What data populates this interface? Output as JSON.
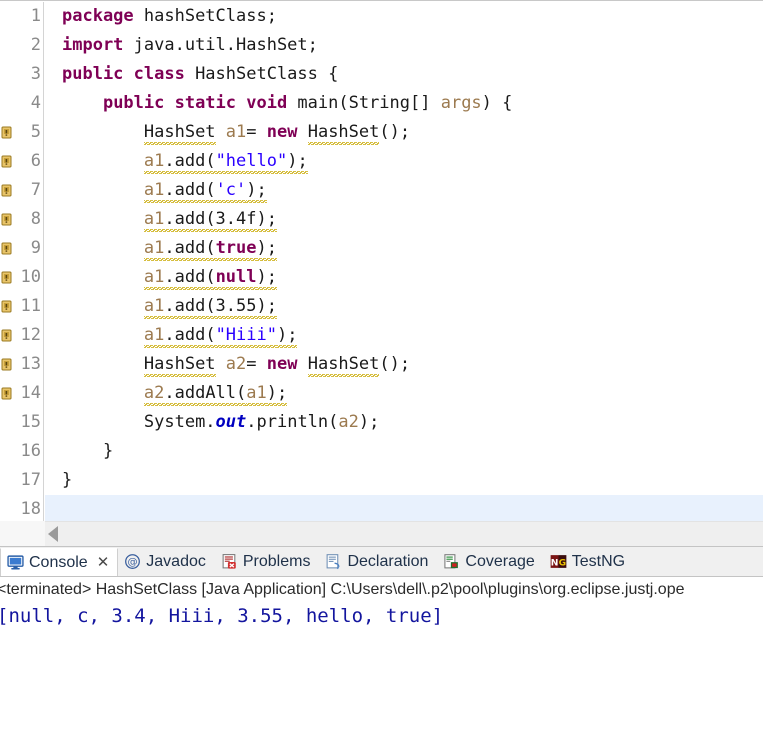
{
  "editor": {
    "language": "java",
    "current_line": 18,
    "total_lines": 18,
    "lines": [
      {
        "num": "1",
        "marker": "none",
        "fold": false,
        "tokens": [
          {
            "t": "package ",
            "c": "kw"
          },
          {
            "t": "hashSetClass;",
            "c": "plain"
          }
        ]
      },
      {
        "num": "2",
        "marker": "none",
        "fold": false,
        "tokens": [
          {
            "t": "import ",
            "c": "kw"
          },
          {
            "t": "java.util.HashSet;",
            "c": "plain"
          }
        ]
      },
      {
        "num": "3",
        "marker": "none",
        "fold": false,
        "tokens": [
          {
            "t": "public class ",
            "c": "kw"
          },
          {
            "t": "HashSetClass {",
            "c": "plain"
          }
        ]
      },
      {
        "num": "4",
        "marker": "none",
        "fold": true,
        "tokens": [
          {
            "t": "    ",
            "c": "plain"
          },
          {
            "t": "public static void ",
            "c": "kw"
          },
          {
            "t": "main(String[] ",
            "c": "plain"
          },
          {
            "t": "args",
            "c": "lvar"
          },
          {
            "t": ") {",
            "c": "plain"
          }
        ]
      },
      {
        "num": "5",
        "marker": "warning",
        "fold": false,
        "tokens": [
          {
            "t": "        ",
            "c": "plain"
          },
          {
            "t": "HashSet",
            "c": "plain",
            "squiggle": true
          },
          {
            "t": " ",
            "c": "plain"
          },
          {
            "t": "a1",
            "c": "lvar"
          },
          {
            "t": "= ",
            "c": "plain"
          },
          {
            "t": "new ",
            "c": "kw"
          },
          {
            "t": "HashSet",
            "c": "plain",
            "squiggle": true
          },
          {
            "t": "();",
            "c": "plain"
          }
        ]
      },
      {
        "num": "6",
        "marker": "warning",
        "fold": false,
        "tokens": [
          {
            "t": "        ",
            "c": "plain"
          },
          {
            "t": "a1",
            "c": "lvar",
            "squiggle": true
          },
          {
            "t": ".add(",
            "c": "plain",
            "squiggle": true
          },
          {
            "t": "\"hello\"",
            "c": "str",
            "squiggle": true
          },
          {
            "t": ");",
            "c": "plain",
            "squiggle": true
          }
        ]
      },
      {
        "num": "7",
        "marker": "warning",
        "fold": false,
        "tokens": [
          {
            "t": "        ",
            "c": "plain"
          },
          {
            "t": "a1",
            "c": "lvar",
            "squiggle": true
          },
          {
            "t": ".add(",
            "c": "plain",
            "squiggle": true
          },
          {
            "t": "'c'",
            "c": "str",
            "squiggle": true
          },
          {
            "t": ");",
            "c": "plain",
            "squiggle": true
          }
        ]
      },
      {
        "num": "8",
        "marker": "warning",
        "fold": false,
        "tokens": [
          {
            "t": "        ",
            "c": "plain"
          },
          {
            "t": "a1",
            "c": "lvar",
            "squiggle": true
          },
          {
            "t": ".add(3.4f);",
            "c": "plain",
            "squiggle": true
          }
        ]
      },
      {
        "num": "9",
        "marker": "warning",
        "fold": false,
        "tokens": [
          {
            "t": "        ",
            "c": "plain"
          },
          {
            "t": "a1",
            "c": "lvar",
            "squiggle": true
          },
          {
            "t": ".add(",
            "c": "plain",
            "squiggle": true
          },
          {
            "t": "true",
            "c": "kw",
            "squiggle": true
          },
          {
            "t": ");",
            "c": "plain",
            "squiggle": true
          }
        ]
      },
      {
        "num": "10",
        "marker": "warning",
        "fold": false,
        "tokens": [
          {
            "t": "        ",
            "c": "plain"
          },
          {
            "t": "a1",
            "c": "lvar",
            "squiggle": true
          },
          {
            "t": ".add(",
            "c": "plain",
            "squiggle": true
          },
          {
            "t": "null",
            "c": "kw",
            "squiggle": true
          },
          {
            "t": ");",
            "c": "plain",
            "squiggle": true
          }
        ]
      },
      {
        "num": "11",
        "marker": "warning",
        "fold": false,
        "tokens": [
          {
            "t": "        ",
            "c": "plain"
          },
          {
            "t": "a1",
            "c": "lvar",
            "squiggle": true
          },
          {
            "t": ".add(3.55);",
            "c": "plain",
            "squiggle": true
          }
        ]
      },
      {
        "num": "12",
        "marker": "warning",
        "fold": false,
        "tokens": [
          {
            "t": "        ",
            "c": "plain"
          },
          {
            "t": "a1",
            "c": "lvar",
            "squiggle": true
          },
          {
            "t": ".add(",
            "c": "plain",
            "squiggle": true
          },
          {
            "t": "\"Hiii\"",
            "c": "str",
            "squiggle": true
          },
          {
            "t": ");",
            "c": "plain",
            "squiggle": true
          }
        ]
      },
      {
        "num": "13",
        "marker": "warning",
        "fold": false,
        "tokens": [
          {
            "t": "        ",
            "c": "plain"
          },
          {
            "t": "HashSet",
            "c": "plain",
            "squiggle": true
          },
          {
            "t": " ",
            "c": "plain"
          },
          {
            "t": "a2",
            "c": "lvar"
          },
          {
            "t": "= ",
            "c": "plain"
          },
          {
            "t": "new ",
            "c": "kw"
          },
          {
            "t": "HashSet",
            "c": "plain",
            "squiggle": true
          },
          {
            "t": "();",
            "c": "plain"
          }
        ]
      },
      {
        "num": "14",
        "marker": "warning",
        "fold": false,
        "tokens": [
          {
            "t": "        ",
            "c": "plain"
          },
          {
            "t": "a2",
            "c": "lvar",
            "squiggle": true
          },
          {
            "t": ".addAll(",
            "c": "plain",
            "squiggle": true
          },
          {
            "t": "a1",
            "c": "lvar",
            "squiggle": true
          },
          {
            "t": ");",
            "c": "plain",
            "squiggle": true
          }
        ]
      },
      {
        "num": "15",
        "marker": "none",
        "fold": false,
        "tokens": [
          {
            "t": "        ",
            "c": "plain"
          },
          {
            "t": "System.",
            "c": "plain"
          },
          {
            "t": "out",
            "c": "sfld"
          },
          {
            "t": ".println(",
            "c": "plain"
          },
          {
            "t": "a2",
            "c": "lvar"
          },
          {
            "t": ");",
            "c": "plain"
          }
        ]
      },
      {
        "num": "16",
        "marker": "none",
        "fold": false,
        "tokens": [
          {
            "t": "    }",
            "c": "plain"
          }
        ]
      },
      {
        "num": "17",
        "marker": "none",
        "fold": false,
        "tokens": [
          {
            "t": "}",
            "c": "plain"
          }
        ]
      },
      {
        "num": "18",
        "marker": "none",
        "fold": false,
        "current": true,
        "tokens": []
      }
    ],
    "change_stripe": {
      "from_line": 4,
      "to_line": 16
    },
    "hscrollbar": {
      "arrow_icon": "scroll-left-arrow-icon"
    }
  },
  "bottom_panel": {
    "tabs": [
      {
        "label": "Console",
        "icon": "console-icon",
        "active": true,
        "closable": true,
        "close_glyph": "✕"
      },
      {
        "label": "Javadoc",
        "icon": "javadoc-icon",
        "active": false,
        "closable": false
      },
      {
        "label": "Problems",
        "icon": "problems-icon",
        "active": false,
        "closable": false
      },
      {
        "label": "Declaration",
        "icon": "declaration-icon",
        "active": false,
        "closable": false
      },
      {
        "label": "Coverage",
        "icon": "coverage-icon",
        "active": false,
        "closable": false
      },
      {
        "label": "TestNG",
        "icon": "testng-icon",
        "active": false,
        "closable": false
      }
    ],
    "console": {
      "process_line": "<terminated> HashSetClass [Java Application] C:\\Users\\dell\\.p2\\pool\\plugins\\org.eclipse.justj.ope",
      "output": "[null, c, 3.4, Hiii, 3.55, hello, true]"
    }
  },
  "colors": {
    "keyword": "#7f0055",
    "string": "#2a00ff",
    "local_var": "#9c7a4f",
    "static_field": "#0000c0",
    "console_output": "#13159e",
    "current_line_highlight": "#e8f1fd",
    "warning_squiggle": "#c8a900",
    "change_bar": "#2f7fd4",
    "tabbar_bg": "#f0f0f0"
  }
}
